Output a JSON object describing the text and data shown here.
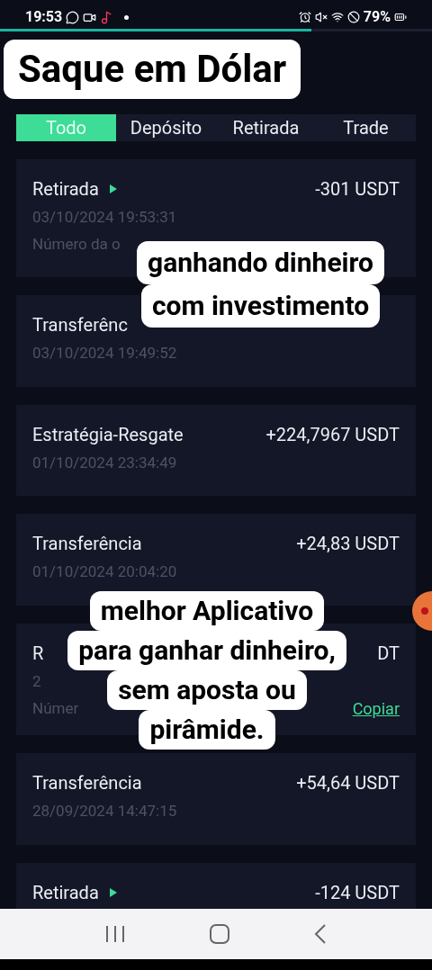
{
  "status_bar": {
    "time": "19:53",
    "battery": "79%"
  },
  "progress": {
    "level": 0.72
  },
  "tabs": [
    {
      "label": "Todo",
      "selected": true
    },
    {
      "label": "Depósito",
      "selected": false
    },
    {
      "label": "Retirada",
      "selected": false
    },
    {
      "label": "Trade",
      "selected": false
    }
  ],
  "transactions": [
    {
      "type": "Retirada",
      "arrow": true,
      "amount": "-301 USDT",
      "date": "03/10/2024 19:53:31",
      "order": "Número da o"
    },
    {
      "type": "Transferênc",
      "arrow": false,
      "date": "03/10/2024 19:49:52"
    },
    {
      "type": "Estratégia-Resgate",
      "arrow": false,
      "amount": "+224,7967 USDT",
      "date": "01/10/2024 23:34:49"
    },
    {
      "type": "Transferência",
      "arrow": false,
      "amount": "+24,83 USDT",
      "date": "01/10/2024 20:04:20"
    },
    {
      "type": "R",
      "arrow": false,
      "amount": "DT",
      "date": "2",
      "order": "Númer",
      "copy": "Copiar"
    },
    {
      "type": "Transferência",
      "arrow": false,
      "amount": "+54,64 USDT",
      "date": "28/09/2024 14:47:15"
    },
    {
      "type": "Retirada",
      "arrow": true,
      "amount": "-124 USDT"
    }
  ],
  "captions": [
    {
      "lines": [
        "Saque em Dólar"
      ]
    },
    {
      "lines": [
        "ganhando dinheiro",
        "com investimento"
      ]
    },
    {
      "lines": [
        "melhor Aplicativo",
        "para ganhar dinheiro,",
        "sem aposta ou",
        "pirâmide."
      ]
    }
  ]
}
